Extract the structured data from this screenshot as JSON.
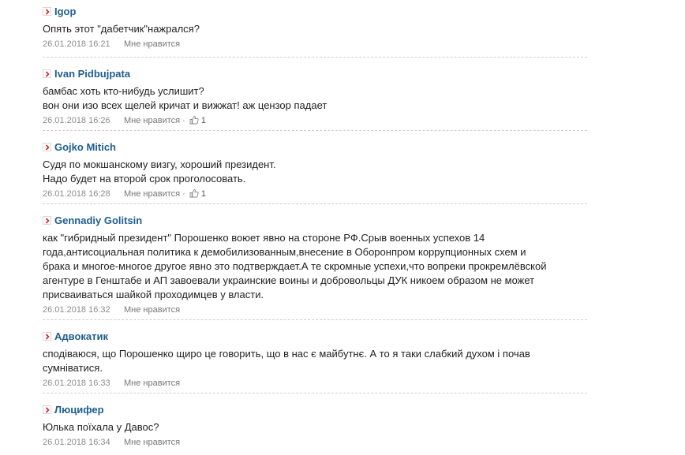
{
  "comments": [
    {
      "author": "Igop",
      "lines": [
        "Опять этот \"дабетчик\"нажрался?"
      ],
      "date": "26.01.2018 16:21",
      "like_label": "Мне нравится",
      "likes": ""
    },
    {
      "author": "Ivan Pidbujpata",
      "lines": [
        "бамбас хоть кто-нибудь услишит?",
        "вон они изо всех щелей кричат и вижжат! аж цензор падает"
      ],
      "date": "26.01.2018 16:26",
      "like_label": "Мне нравится",
      "likes": "1"
    },
    {
      "author": "Gojko Mitich",
      "lines": [
        "Судя по мокшанскому визгу, хороший президент.",
        "Надо будет на второй срок проголосовать."
      ],
      "date": "26.01.2018 16:28",
      "like_label": "Мне нравится",
      "likes": "1"
    },
    {
      "author": "Gennadiy Golitsin",
      "lines": [
        "как \"гибридный президент\" Порошенко воюет явно на стороне РФ.Срыв военных успехов 14",
        "года,антисоциальная политика к демобилизованным,внесение в Оборонпром коррупционных схем и",
        "брака и многое-многое другое явно это подтверждает.А те скромные успехи,что вопреки прокремлёвской",
        "агентуре в Генштабе и АП завоевали украинские воины и добровольцы ДУК никоем образом не может",
        "присваиваться шайкой проходимцев у власти."
      ],
      "date": "26.01.2018 16:32",
      "like_label": "Мне нравится",
      "likes": ""
    },
    {
      "author": "Адвокатик",
      "lines": [
        "сподіваюся, що Порошенко щиро це говорить, що в нас є майбутнє. А то я таки слабкий духом і почав",
        "сумніватися."
      ],
      "date": "26.01.2018 16:33",
      "like_label": "Мне нравится",
      "likes": ""
    },
    {
      "author": "Люцифер",
      "lines": [
        "Юлька поїхала у Давос?"
      ],
      "date": "26.01.2018 16:34",
      "like_label": "Мне нравится",
      "likes": ""
    }
  ],
  "colors": {
    "author": "#1f5e8c",
    "arrow": "#d0252b",
    "meta": "#8c8c8c"
  },
  "icons": {
    "author_marker": "chevron-right-icon",
    "like": "thumbs-up-icon"
  }
}
